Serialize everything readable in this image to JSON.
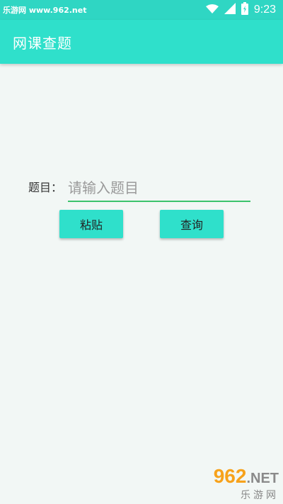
{
  "status_bar": {
    "left_text": "乐游网 www.962.net",
    "time": "9:23",
    "icons": [
      "wifi-icon",
      "signal-icon",
      "battery-icon"
    ]
  },
  "app_bar": {
    "title": "网课查题"
  },
  "form": {
    "label": "题目：",
    "input_value": "",
    "input_placeholder": "请输入题目"
  },
  "buttons": {
    "paste_label": "粘贴",
    "query_label": "查询"
  },
  "watermark": {
    "top": "962",
    "net": ".NET",
    "bottom": "乐游网"
  },
  "colors": {
    "accent": "#2fe0cb",
    "underline": "#3cc36c",
    "background": "#f2f7f5"
  }
}
